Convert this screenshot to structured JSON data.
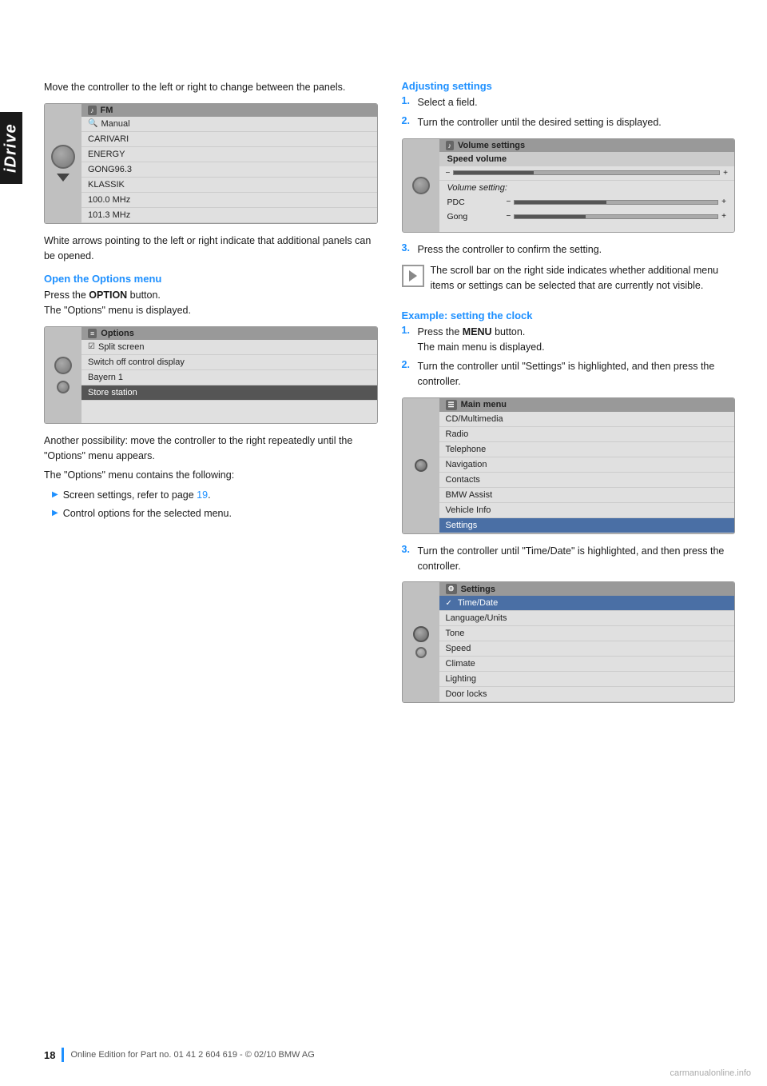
{
  "sidetab": {
    "label": "iDrive"
  },
  "left_col": {
    "intro_text": "Move the controller to the left or right to change between the panels.",
    "screen1": {
      "title": "FM",
      "title_icon": "radio-icon",
      "rows": [
        {
          "label": "Manual",
          "type": "normal"
        },
        {
          "label": "CARIVARI",
          "type": "normal"
        },
        {
          "label": "ENERGY",
          "type": "normal"
        },
        {
          "label": "GONG96.3",
          "type": "normal"
        },
        {
          "label": "KLASSIK",
          "type": "normal"
        },
        {
          "label": "100.0 MHz",
          "type": "normal"
        },
        {
          "label": "101.3 MHz",
          "type": "normal"
        }
      ]
    },
    "white_arrows_text": "White arrows pointing to the left or right indicate that additional panels can be opened.",
    "options_heading": "Open the Options menu",
    "options_intro": "Press the OPTION button.\nThe \"Options\" menu is displayed.",
    "screen2": {
      "title": "Options",
      "title_icon": "options-icon",
      "rows": [
        {
          "label": "Split screen",
          "type": "checkbox"
        },
        {
          "label": "Switch off control display",
          "type": "normal"
        },
        {
          "label": "Bayern 1",
          "type": "normal"
        },
        {
          "label": "Store station",
          "type": "selected"
        }
      ]
    },
    "possibility_text": "Another possibility: move the controller to the right repeatedly until the \"Options\" menu appears.",
    "contains_text": "The \"Options\" menu contains the following:",
    "bullets": [
      {
        "text": "Screen settings, refer to page 19.",
        "link": "19"
      },
      {
        "text": "Control options for the selected menu."
      }
    ]
  },
  "right_col": {
    "adjusting_heading": "Adjusting settings",
    "adj_steps": [
      {
        "num": "1.",
        "text": "Select a field."
      },
      {
        "num": "2.",
        "text": "Turn the controller until the desired setting is displayed."
      }
    ],
    "screen_volume": {
      "title": "Volume settings",
      "title_icon": "volume-icon",
      "speed_label": "Speed volume",
      "vol_setting_label": "Volume setting:",
      "rows": [
        {
          "label": "PDC",
          "type": "vol"
        },
        {
          "label": "Gong",
          "type": "vol"
        }
      ]
    },
    "adj_step3": {
      "num": "3.",
      "text": "Press the controller to confirm the setting."
    },
    "note_text": "The scroll bar on the right side indicates whether additional menu items or settings can be selected that are currently not visible.",
    "example_heading": "Example: setting the clock",
    "example_steps": [
      {
        "num": "1.",
        "text": "Press the MENU button.\nThe main menu is displayed."
      },
      {
        "num": "2.",
        "text": "Turn the controller until \"Settings\" is highlighted, and then press the controller."
      }
    ],
    "screen_main": {
      "title": "Main menu",
      "title_icon": "menu-icon",
      "rows": [
        {
          "label": "CD/Multimedia",
          "type": "normal"
        },
        {
          "label": "Radio",
          "type": "normal"
        },
        {
          "label": "Telephone",
          "type": "normal"
        },
        {
          "label": "Navigation",
          "type": "normal"
        },
        {
          "label": "Contacts",
          "type": "normal"
        },
        {
          "label": "BMW Assist",
          "type": "normal"
        },
        {
          "label": "Vehicle Info",
          "type": "normal"
        },
        {
          "label": "Settings",
          "type": "selected"
        }
      ]
    },
    "example_step3": {
      "num": "3.",
      "text": "Turn the controller until \"Time/Date\" is highlighted, and then press the controller."
    },
    "screen_settings": {
      "title": "Settings",
      "title_icon": "settings-icon",
      "rows": [
        {
          "label": "Time/Date",
          "type": "selected-check"
        },
        {
          "label": "Language/Units",
          "type": "normal"
        },
        {
          "label": "Tone",
          "type": "normal"
        },
        {
          "label": "Speed",
          "type": "normal"
        },
        {
          "label": "Climate",
          "type": "normal"
        },
        {
          "label": "Lighting",
          "type": "normal"
        },
        {
          "label": "Door locks",
          "type": "normal"
        }
      ]
    }
  },
  "footer": {
    "page_number": "18",
    "footer_text": "Online Edition for Part no. 01 41 2 604 619 - © 02/10 BMW AG"
  },
  "watermark": {
    "text": "carmanualonline.info"
  }
}
